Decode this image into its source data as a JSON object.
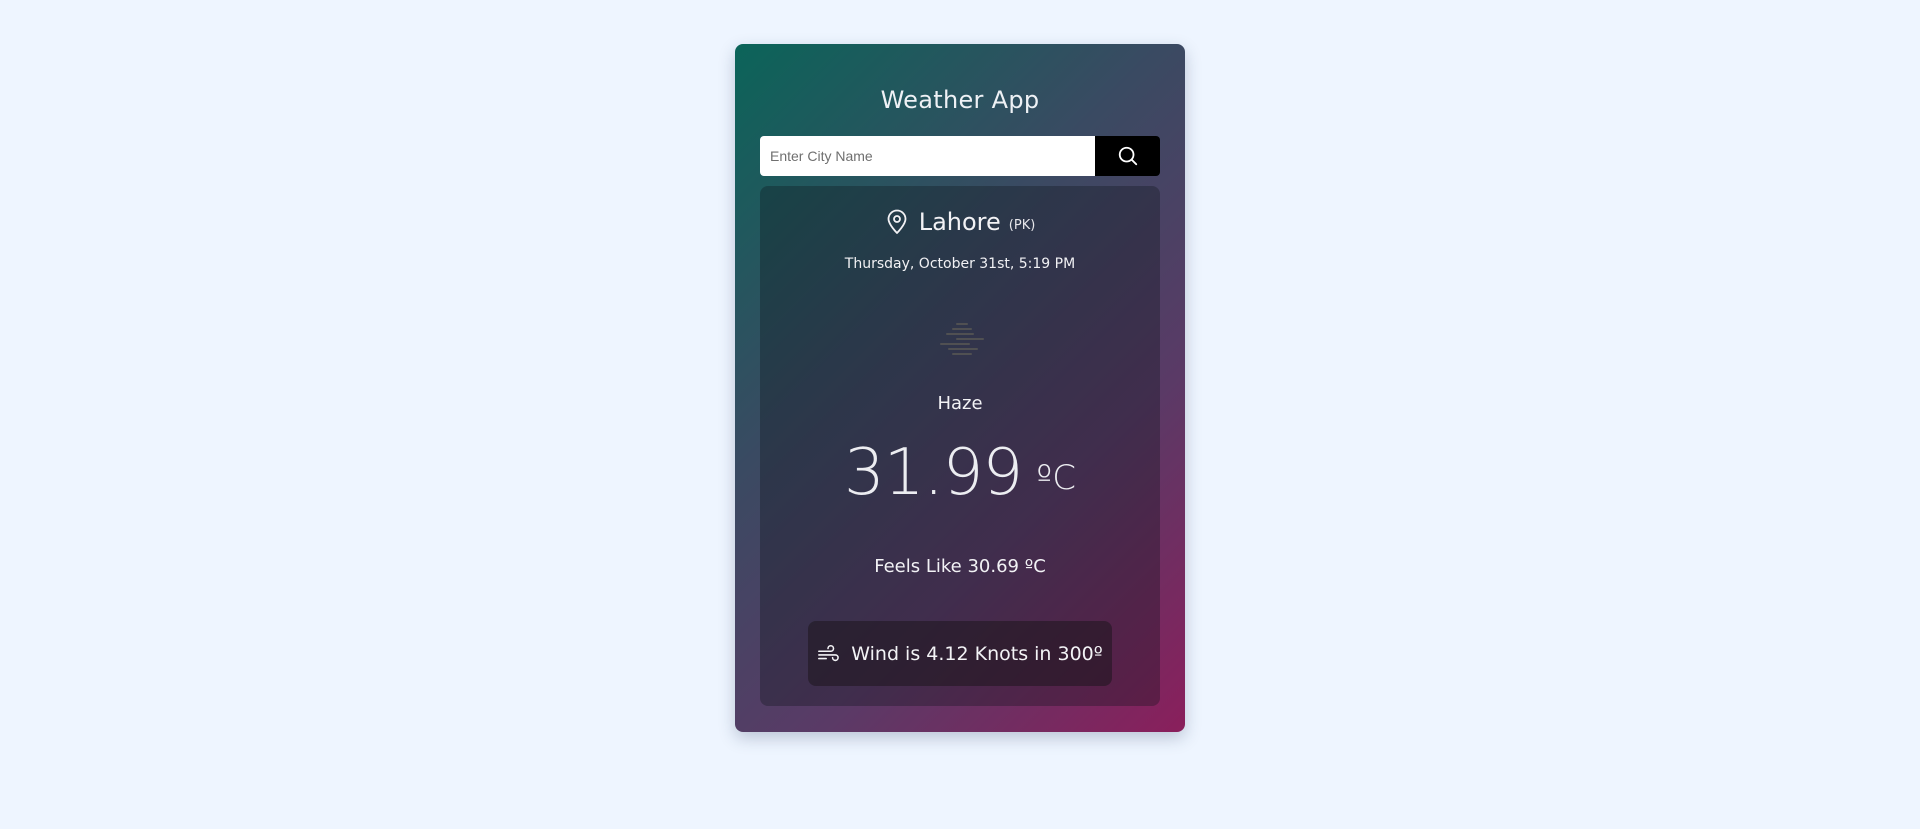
{
  "app": {
    "title": "Weather App"
  },
  "search": {
    "placeholder": "Enter City Name",
    "value": "",
    "button_icon": "search-icon"
  },
  "weather": {
    "location_icon": "map-pin-icon",
    "city": "Lahore",
    "country": "(PK)",
    "datetime": "Thursday, October 31st, 5:19 PM",
    "condition_icon": "haze-icon",
    "condition": "Haze",
    "temperature": "31.99",
    "temperature_unit": "ºC",
    "feels_like": "Feels Like 30.69 ºC",
    "wind_icon": "wind-icon",
    "wind": "Wind is 4.12 Knots in 300º"
  },
  "colors": {
    "page_background": "#eef5ff",
    "card_gradient_start": "#0b6459",
    "card_gradient_end": "#8a1f5c",
    "search_button": "#000000",
    "text": "#f2f2f5"
  }
}
